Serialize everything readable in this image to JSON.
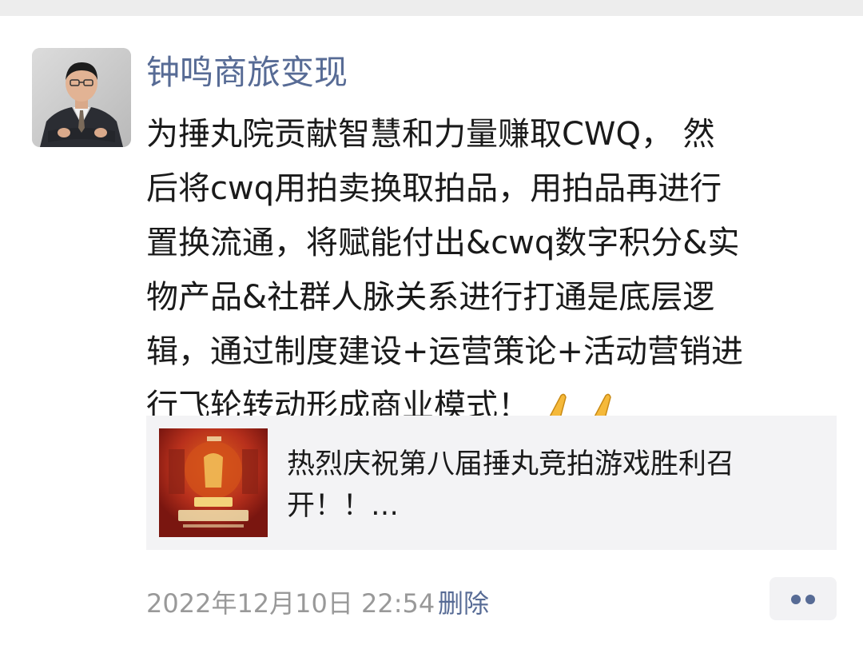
{
  "post": {
    "author_name": "钟鸣商旅变现",
    "avatar_icon": "person-photo-icon",
    "text_lines": [
      "为捶丸院贡献智慧和力量赚取CWQ， 然",
      "后将cwq用拍卖换取拍品，用拍品再进行",
      "置换流通，将赋能付出&cwq数字积分&实",
      "物产品&社群人脉关系进行打通是底层逻",
      "辑，通过制度建设+运营策论+活动营销进",
      "行飞轮转动形成商业模式！"
    ],
    "emoji_icon": "folded-hands-emoji",
    "shared_link": {
      "title_lines": [
        "热烈庆祝第八届捶丸竞拍游戏胜利召",
        "开！！…"
      ],
      "thumbnail_icon": "event-poster-thumbnail"
    },
    "timestamp": "2022年12月10日 22:54",
    "delete_label": "删除",
    "more_icon": "more-dots-icon"
  },
  "colors": {
    "link_blue": "#576b95",
    "text_primary": "#1a1a1a",
    "text_secondary": "#999999",
    "card_background": "#f3f3f5",
    "top_strip": "#ededed"
  }
}
